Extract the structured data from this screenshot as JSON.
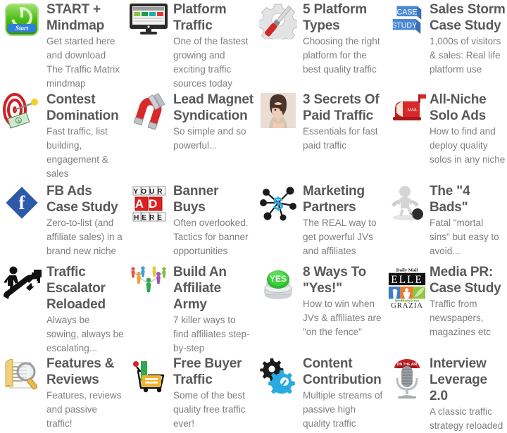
{
  "page": {
    "type": "course-module-grid",
    "columns": 4,
    "rows": 5,
    "title_color": "#58595b",
    "desc_color": "#7d7f82",
    "background": "#ffffff"
  },
  "items": [
    {
      "title": "START + Mindmap",
      "desc": "Get started here and download The Traffic Matrix mindmap",
      "icon": "green-start-power-button-icon",
      "icon_label": "Start"
    },
    {
      "title": "Platform Traffic",
      "desc": "One of the fastest growing and exciting traffic sources today",
      "icon": "desktop-monitor-icon"
    },
    {
      "title": "5 Platform Types",
      "desc": "Choosing the right platform for the best quality traffic",
      "icon": "gear-screwdriver-icon"
    },
    {
      "title": "Sales Storm Case Study",
      "desc": "1,000s of visitors & sales: Real life platform use",
      "icon": "case-study-blocks-icon",
      "icon_label_top": "CASE",
      "icon_label_bottom": "STUDY"
    },
    {
      "title": "Contest Domination",
      "desc": "Fast traffic, list building, engagement & sales",
      "icon": "target-dart-money-icon"
    },
    {
      "title": "Lead Magnet Syndication",
      "desc": "So simple and so powerful...",
      "icon": "horseshoe-magnet-icon"
    },
    {
      "title": "3 Secrets Of Paid Traffic",
      "desc": "Essentials for fast paid traffic",
      "icon": "woman-shushing-photo-icon"
    },
    {
      "title": "All-Niche Solo Ads",
      "desc": "How to find and deploy quality solos in any niche",
      "icon": "red-mailbox-icon",
      "icon_label": "MAIL"
    },
    {
      "title": "FB Ads Case Study",
      "desc": "Zero-to-list (and affiliate sales) in a brand new niche",
      "icon": "facebook-diamond-icon",
      "icon_label": "f"
    },
    {
      "title": "Banner Buys",
      "desc": "Often overlooked. Tactics for banner opportunities",
      "icon": "your-ad-here-blocks-icon",
      "icon_label_top": "YOUR",
      "icon_label_mid": "AD",
      "icon_label_bottom": "HERE"
    },
    {
      "title": "Marketing Partners",
      "desc": "The REAL way to get powerful JVs and affiliates",
      "icon": "network-dollar-nodes-icon",
      "icon_label": "$"
    },
    {
      "title": "The \"4 Bads\"",
      "desc": "Fatal \"mortal sins\" but easy to avoid...",
      "icon": "figure-ball-and-chain-icon"
    },
    {
      "title": "Traffic Escalator Reloaded",
      "desc": "Always be sowing, always be escalating...",
      "icon": "escalator-arrow-icon"
    },
    {
      "title": "Build An Affiliate Army",
      "desc": "7 killer ways to find affiliates step-by-step",
      "icon": "colorful-people-network-icon"
    },
    {
      "title": "8 Ways To \"Yes!\"",
      "desc": "How to win when JVs & affiliates are \"on the fence\"",
      "icon": "green-yes-button-icon",
      "icon_label": "YES"
    },
    {
      "title": "Media PR: Case Study",
      "desc": "Traffic from newspapers, magazines etc",
      "icon": "media-logos-collage-icon",
      "icon_label_1": "Daily Mail",
      "icon_label_2": "ELLE",
      "icon_label_3": "MindBodyGreen",
      "icon_label_4": "GRAZIA"
    },
    {
      "title": "Features & Reviews",
      "desc": "Features, reviews and passive traffic!",
      "icon": "document-magnifier-icon"
    },
    {
      "title": "Free Buyer Traffic",
      "desc": "Some of the best quality free traffic ever!",
      "icon": "shopping-cart-download-icon"
    },
    {
      "title": "Content Contribution",
      "desc": "Multiple streams of passive high quality traffic",
      "icon": "two-gears-icon"
    },
    {
      "title": "Interview Leverage 2.0",
      "desc": "A classic traffic strategy reloaded",
      "icon": "on-the-air-microphone-icon",
      "icon_label": "ON THE AIR"
    }
  ]
}
